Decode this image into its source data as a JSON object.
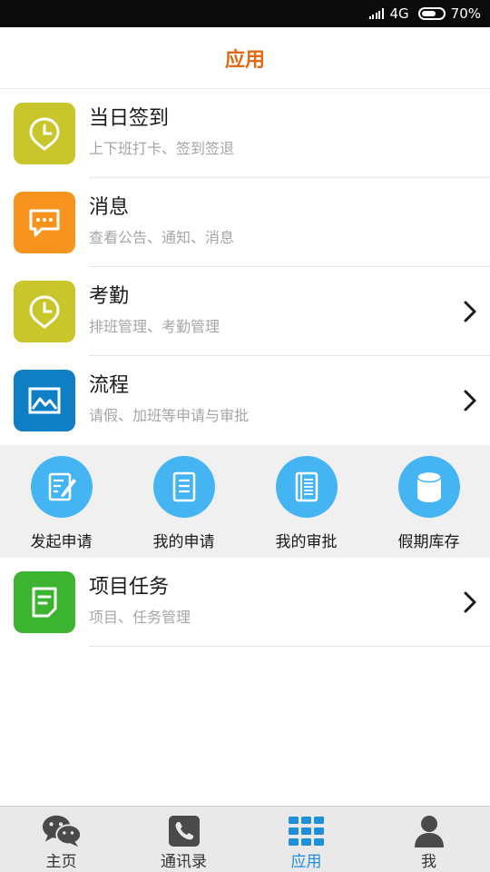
{
  "status_bar": {
    "network": "4G",
    "battery": "70%",
    "battery_level": 0.7
  },
  "header": {
    "title": "应用"
  },
  "list": [
    {
      "title": "当日签到",
      "subtitle": "上下班打卡、签到签退",
      "icon": "clock-pin-icon",
      "color": "#c9c62c",
      "chevron": false
    },
    {
      "title": "消息",
      "subtitle": "查看公告、通知、消息",
      "icon": "message-icon",
      "color": "#f7941d",
      "chevron": false
    },
    {
      "title": "考勤",
      "subtitle": "排班管理、考勤管理",
      "icon": "clock-pin-icon",
      "color": "#c9c62c",
      "chevron": true
    },
    {
      "title": "流程",
      "subtitle": "请假、加班等申请与审批",
      "icon": "picture-icon",
      "color": "#0e7ec5",
      "chevron": true
    }
  ],
  "quick_actions": [
    {
      "label": "发起申请",
      "icon": "edit-form-icon"
    },
    {
      "label": "我的申请",
      "icon": "document-icon"
    },
    {
      "label": "我的审批",
      "icon": "notebook-icon"
    },
    {
      "label": "假期库存",
      "icon": "database-icon"
    }
  ],
  "project": {
    "title": "项目任务",
    "subtitle": "项目、任务管理",
    "icon": "task-note-icon",
    "color": "#3cb331",
    "chevron": true
  },
  "tabs": [
    {
      "label": "主页",
      "icon": "chat-icon",
      "active": false
    },
    {
      "label": "通讯录",
      "icon": "phone-icon",
      "active": false
    },
    {
      "label": "应用",
      "icon": "grid-icon",
      "active": true
    },
    {
      "label": "我",
      "icon": "person-icon",
      "active": false
    }
  ],
  "colors": {
    "accent": "#e06a15",
    "quick_circle": "#45b4f2",
    "tab_active": "#1e8fd8",
    "tab_inactive": "#4a4a4a"
  }
}
